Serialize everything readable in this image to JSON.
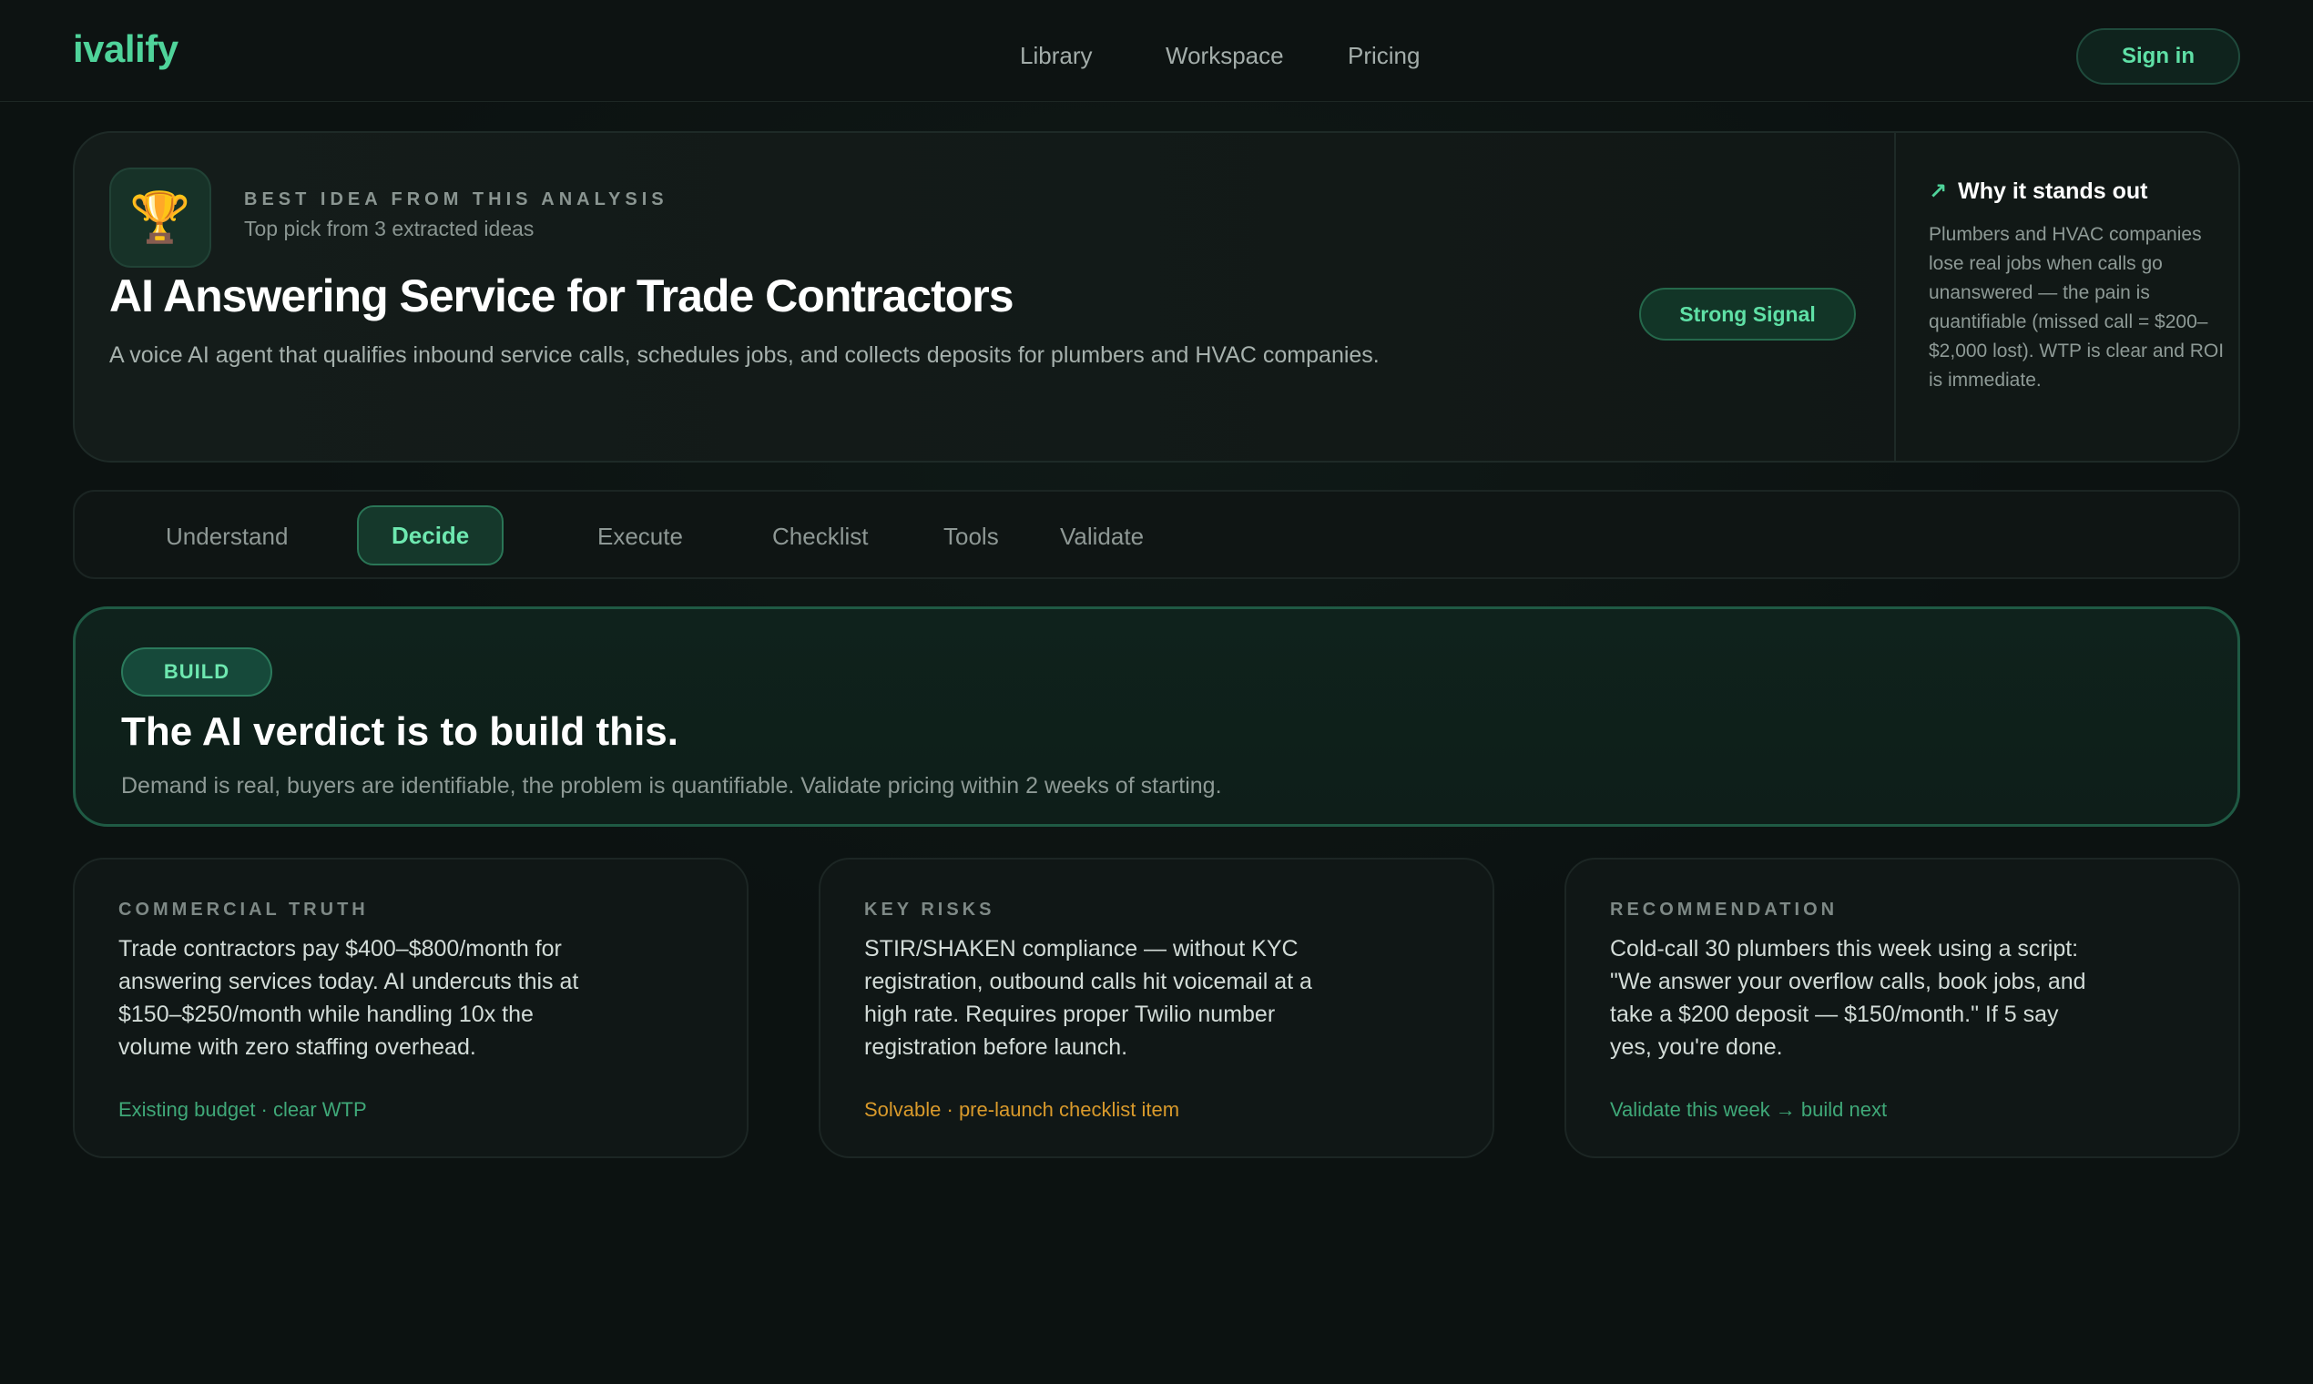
{
  "header": {
    "logo": "ivalify",
    "nav": [
      "Library",
      "Workspace",
      "Pricing"
    ],
    "signin_label": "Sign in"
  },
  "hero": {
    "icon": "trophy-icon",
    "eyebrow": "BEST IDEA FROM THIS ANALYSIS",
    "subeyebrow": "Top pick from 3 extracted ideas",
    "title": "AI Answering Service for Trade Contractors",
    "description": "A voice AI agent that qualifies inbound service calls, schedules jobs, and collects deposits for plumbers and HVAC companies.",
    "signal": "Strong Signal",
    "why": {
      "heading": "Why it stands out",
      "body": "Plumbers and HVAC companies lose real jobs when calls go unanswered — the pain is quantifiable (missed call = $200–$2,000 lost). WTP is clear and ROI is immediate."
    }
  },
  "tabs": {
    "items": [
      "Understand",
      "Decide",
      "Execute",
      "Checklist",
      "Tools",
      "Validate"
    ],
    "active": "Decide"
  },
  "verdict": {
    "badge": "BUILD",
    "title": "The AI verdict is to build this.",
    "description": "Demand is real, buyers are identifiable, the problem is quantifiable. Validate pricing within 2 weeks of starting."
  },
  "cards": [
    {
      "label": "COMMERCIAL TRUTH",
      "body": "Trade contractors pay $400–$800/month for answering services today. AI undercuts this at $150–$250/month while handling 10x the volume with zero staffing overhead.",
      "footer": "Existing budget · clear WTP",
      "footer_color": "#3fa878"
    },
    {
      "label": "KEY RISKS",
      "body": "STIR/SHAKEN compliance — without KYC registration, outbound calls hit voicemail at a high rate. Requires proper Twilio number registration before launch.",
      "footer": "Solvable · pre-launch checklist item",
      "footer_color": "#d99a2b"
    },
    {
      "label": "RECOMMENDATION",
      "body": "Cold-call 30 plumbers this week using a script: \"We answer your overflow calls, book jobs, and take a $200 deposit — $150/month.\" If 5 say yes, you're done.",
      "footer": "Validate this week → build next",
      "footer_color": "#3fa878"
    }
  ],
  "colors": {
    "accent": "#4fd39a",
    "background": "#0c1211",
    "warning": "#d99a2b"
  }
}
